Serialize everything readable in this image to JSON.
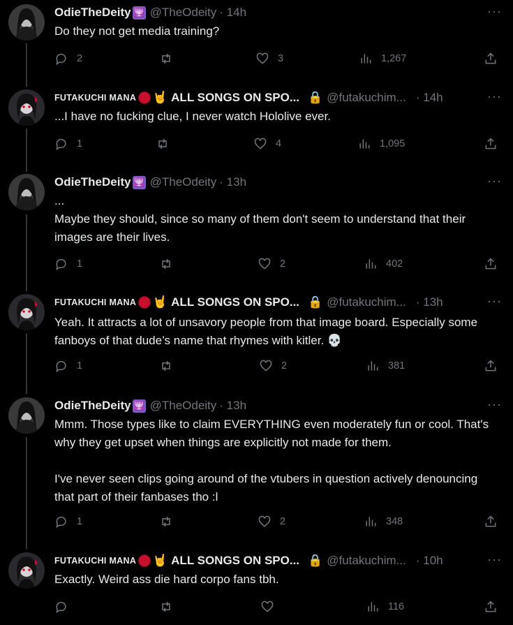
{
  "tweets": [
    {
      "author": "OdieTheDeity",
      "author_style": "normal",
      "emoji": "🕎",
      "handle": "@TheOdeity",
      "time": "· 14h",
      "more": "···",
      "text": "Do they not get media training?",
      "replies": "2",
      "retweets": "",
      "likes": "3",
      "views": "1,267"
    },
    {
      "author": "FUTAKUCHI MANA",
      "author_style": "caps",
      "emoji_red": "🔴",
      "emoji_hand": "🤘",
      "songs": "ALL SONGS ON SPO...",
      "lock": "🔒",
      "handle": "@futakuchim...",
      "time": "· 14h",
      "more": "···",
      "text": "...I have no fucking clue, I never watch Hololive ever.",
      "replies": "1",
      "retweets": "",
      "likes": "4",
      "views": "1,095"
    },
    {
      "author": "OdieTheDeity",
      "author_style": "normal",
      "emoji": "🕎",
      "handle": "@TheOdeity",
      "time": "· 13h",
      "more": "···",
      "text": "...\nMaybe they should, since so many of them don't seem to understand that their images are their lives.",
      "replies": "1",
      "retweets": "",
      "likes": "2",
      "views": "402"
    },
    {
      "author": "FUTAKUCHI MANA",
      "author_style": "caps",
      "emoji_red": "🔴",
      "emoji_hand": "🤘",
      "songs": "ALL SONGS ON SPO...",
      "lock": "🔒",
      "handle": "@futakuchim...",
      "time": "· 13h",
      "more": "···",
      "text": "Yeah. It attracts a lot of unsavory people from that image board. Especially some fanboys of that dude’s name that rhymes with kitler. 💀",
      "replies": "1",
      "retweets": "",
      "likes": "2",
      "views": "381"
    },
    {
      "author": "OdieTheDeity",
      "author_style": "normal",
      "emoji": "🕎",
      "handle": "@TheOdeity",
      "time": "· 13h",
      "more": "···",
      "text": "Mmm. Those types like to claim EVERYTHING even moderately fun or cool. That's why they get upset when things are explicitly not made for them.\n\nI've never seen clips going around of the vtubers in question actively denouncing that part of their fanbases tho :l",
      "replies": "1",
      "retweets": "",
      "likes": "2",
      "views": "348"
    },
    {
      "author": "FUTAKUCHI MANA",
      "author_style": "caps",
      "emoji_red": "🔴",
      "emoji_hand": "🤘",
      "songs": "ALL SONGS ON SPO...",
      "lock": "🔒",
      "handle": "@futakuchim...",
      "time": "· 10h",
      "more": "···",
      "text": "Exactly. Weird ass die hard corpo fans tbh.",
      "replies": "",
      "retweets": "",
      "likes": "",
      "views": "116"
    }
  ]
}
